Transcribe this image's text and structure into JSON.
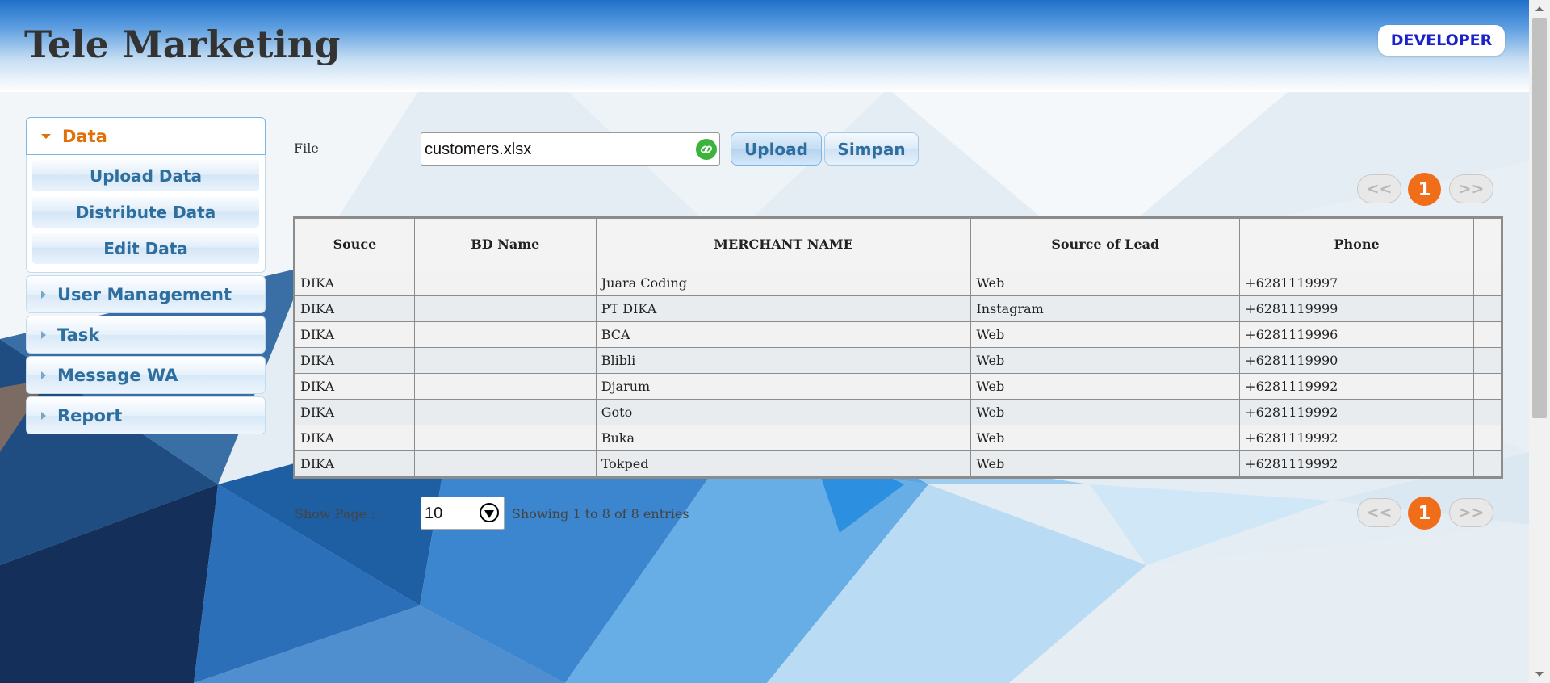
{
  "header": {
    "title": "Tele Marketing",
    "badge": "DEVELOPER"
  },
  "sidebar": {
    "sections": [
      {
        "label": "Data",
        "expanded": true,
        "items": [
          "Upload Data",
          "Distribute Data",
          "Edit Data"
        ]
      },
      {
        "label": "User Management",
        "expanded": false
      },
      {
        "label": "Task",
        "expanded": false
      },
      {
        "label": "Message WA",
        "expanded": false
      },
      {
        "label": "Report",
        "expanded": false
      }
    ]
  },
  "upload": {
    "file_label": "File",
    "file_value": "customers.xlsx",
    "file_icon": "link-icon",
    "upload_label": "Upload",
    "save_label": "Simpan"
  },
  "pagination": {
    "prev": "<<",
    "current": "1",
    "next": ">>"
  },
  "table": {
    "columns": [
      "Souce",
      "BD Name",
      "MERCHANT NAME",
      "Source of Lead",
      "Phone",
      ""
    ],
    "rows": [
      [
        "DIKA",
        "",
        "Juara Coding",
        "Web",
        "+6281119997",
        ""
      ],
      [
        "DIKA",
        "",
        "PT DIKA",
        "Instagram",
        "+6281119999",
        ""
      ],
      [
        "DIKA",
        "",
        "BCA",
        "Web",
        "+6281119996",
        ""
      ],
      [
        "DIKA",
        "",
        "Blibli",
        "Web",
        "+6281119990",
        ""
      ],
      [
        "DIKA",
        "",
        "Djarum",
        "Web",
        "+6281119992",
        ""
      ],
      [
        "DIKA",
        "",
        "Goto",
        "Web",
        "+6281119992",
        ""
      ],
      [
        "DIKA",
        "",
        "Buka",
        "Web",
        "+6281119992",
        ""
      ],
      [
        "DIKA",
        "",
        "Tokped",
        "Web",
        "+6281119992",
        ""
      ]
    ]
  },
  "footer": {
    "show_label": "Show Page :",
    "page_size": "10",
    "entries_text": "Showing 1 to 8 of 8 entries"
  },
  "colors": {
    "accent_orange": "#f06d1a",
    "link_blue": "#2e6e9e",
    "header_blue": "#1f6fc9",
    "badge_text": "#1a22c9"
  }
}
